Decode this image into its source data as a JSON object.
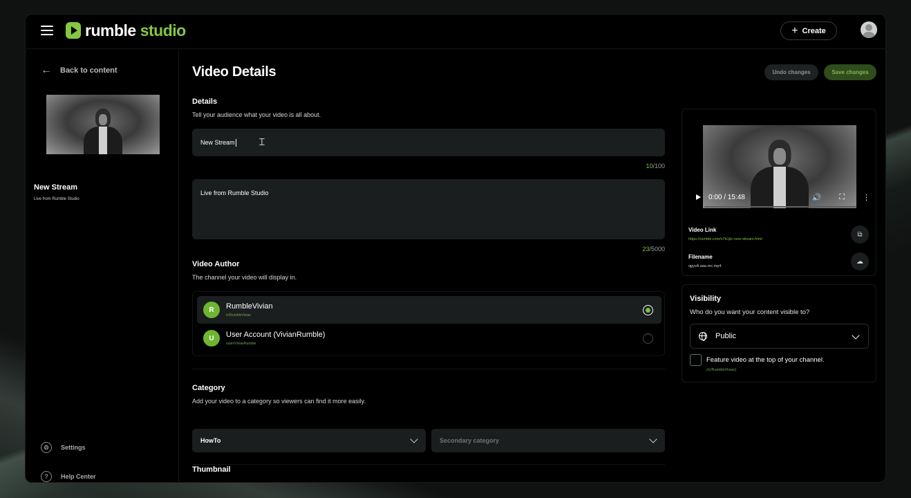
{
  "header": {
    "logo_word1": "rumble",
    "logo_word2": "studio",
    "create_label": "Create"
  },
  "sidebar": {
    "back_label": "Back to content",
    "video_title": "New Stream",
    "video_subtitle": "Live from Rumble Studio",
    "settings_label": "Settings",
    "help_label": "Help Center"
  },
  "main": {
    "page_title": "Video Details",
    "undo_label": "Undo changes",
    "save_label": "Save changes",
    "details": {
      "title": "Details",
      "description": "Tell your audience what your video is all about.",
      "title_value": "New Stream",
      "title_count_used": "10",
      "title_count_max": "/100",
      "desc_value": "Live from Rumble Studio",
      "desc_count_used": "23",
      "desc_count_max": "/5000"
    },
    "author": {
      "title": "Video Author",
      "description": "The channel your video will display in.",
      "options": [
        {
          "initial": "R",
          "name": "RumbleVivian",
          "handle": "/c/RumbleVivian",
          "selected": true
        },
        {
          "initial": "U",
          "name": "User Account (VivianRumble)",
          "handle": "/user/VivianRumble",
          "selected": false
        }
      ]
    },
    "category": {
      "title": "Category",
      "description": "Add your video to a category so viewers can find it more easily.",
      "primary": "HowTo",
      "secondary_placeholder": "Secondary category"
    },
    "thumbnail_title": "Thumbnail"
  },
  "video_panel": {
    "time": "0:00 / 15:48",
    "progress": 0,
    "link_label": "Video Link",
    "link_value": "https://rumble.com/v7b1jtc-new-stream.html",
    "filename_label": "Filename",
    "filename_value": "qgyvA.aaa.rec.mp4"
  },
  "visibility": {
    "title": "Visibility",
    "description": "Who do you want your content visible to?",
    "selected": "Public",
    "feature_label": "Feature video at the top of your channel.",
    "feature_handle": "(/c/RumbleVivian)",
    "feature_checked": false
  },
  "colors": {
    "accent": "#85c742",
    "save_bg": "#2f4d1a",
    "field_bg": "#1b1e1e"
  },
  "icons": [
    "menu-icon",
    "play-logo-icon",
    "plus-icon",
    "avatar-icon",
    "arrow-left-icon",
    "gear-icon",
    "help-icon",
    "play-icon",
    "volume-icon",
    "fullscreen-icon",
    "more-icon",
    "copy-icon",
    "download-icon",
    "globe-icon",
    "chevron-down-icon"
  ]
}
